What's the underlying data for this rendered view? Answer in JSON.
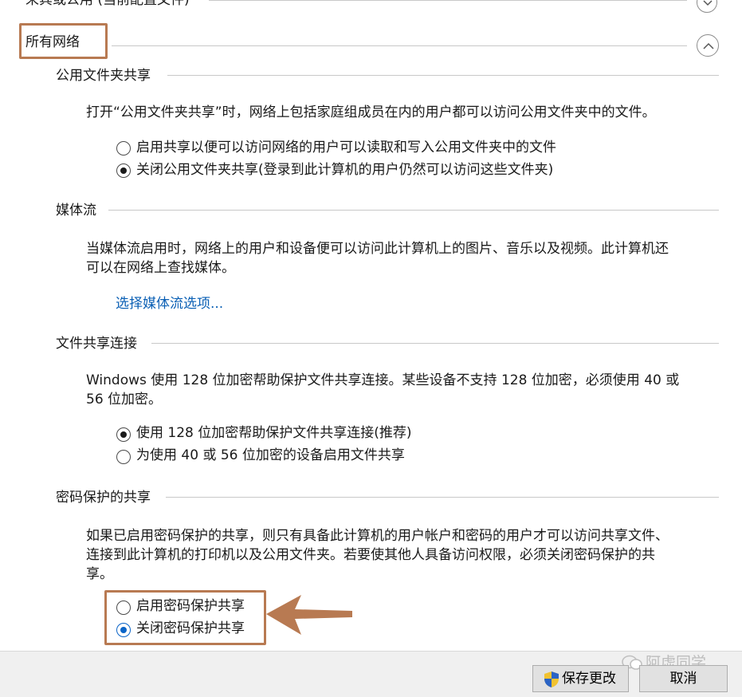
{
  "sections": {
    "top_partial_title": "来宾或公用 (当前配置文件)",
    "all_networks_title": "所有网络",
    "public_folder": {
      "title": "公用文件夹共享",
      "desc": "打开“公用文件夹共享”时，网络上包括家庭组成员在内的用户都可以访问公用文件夹中的文件。",
      "option_on": "启用共享以便可以访问网络的用户可以读取和写入公用文件夹中的文件",
      "option_off": "关闭公用文件夹共享(登录到此计算机的用户仍然可以访问这些文件夹)"
    },
    "media": {
      "title": "媒体流",
      "desc_line1": "当媒体流启用时，网络上的用户和设备便可以访问此计算机上的图片、音乐以及视频。此计算机还",
      "desc_line2": "可以在网络上查找媒体。",
      "link": "选择媒体流选项..."
    },
    "file_sharing": {
      "title": "文件共享连接",
      "desc_line1": "Windows 使用 128 位加密帮助保护文件共享连接。某些设备不支持 128 位加密，必须使用 40 或",
      "desc_line2": "56 位加密。",
      "option_128": "使用 128 位加密帮助保护文件共享连接(推荐)",
      "option_40_56": "为使用 40 或 56 位加密的设备启用文件共享"
    },
    "password": {
      "title": "密码保护的共享",
      "desc_line1": "如果已启用密码保护的共享，则只有具备此计算机的用户帐户和密码的用户才可以访问共享文件、",
      "desc_line2": "连接到此计算机的打印机以及公用文件夹。若要使其他人具备访问权限，必须关闭密码保护的共",
      "desc_line3": "享。",
      "option_on": "启用密码保护共享",
      "option_off": "关闭密码保护共享"
    }
  },
  "footer": {
    "save_label": "保存更改",
    "cancel_label": "取消"
  },
  "watermark": "阿虚同学",
  "colors": {
    "highlight": "#b87a52",
    "link": "#0a5fb4",
    "radio_selected_blue": "#0a64c8"
  }
}
